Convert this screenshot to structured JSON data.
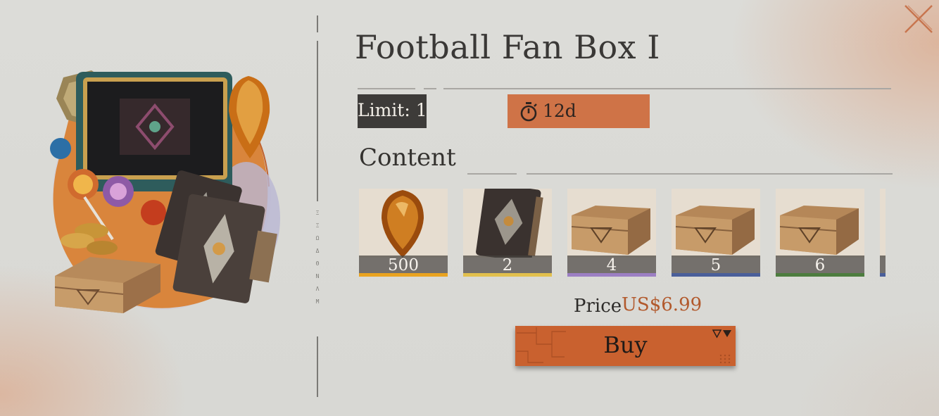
{
  "window": {
    "close_icon": "close-x-icon"
  },
  "hero": {
    "icon": "bundle-art-chest-book-crystal"
  },
  "divider": {
    "glyphs": [
      "Ξ",
      "Ξ",
      "Ω",
      "Δ",
      "Θ",
      "N",
      "Λ",
      "M"
    ]
  },
  "title": "Football Fan Box I",
  "limit_label": "Limit: 1",
  "timer": {
    "icon": "stopwatch-icon",
    "value": "12d"
  },
  "content_label": "Content",
  "items": [
    {
      "icon": "amber-crystal-icon",
      "quantity": "500",
      "rarity_color": "#e9a320"
    },
    {
      "icon": "dark-tome-icon",
      "quantity": "2",
      "rarity_color": "#e2c04d"
    },
    {
      "icon": "wooden-crate-icon",
      "quantity": "4",
      "rarity_color": "#9c7fc3"
    },
    {
      "icon": "wooden-crate-icon",
      "quantity": "5",
      "rarity_color": "#4a5f9a"
    },
    {
      "icon": "wooden-crate-icon",
      "quantity": "6",
      "rarity_color": "#4d7d3f"
    },
    {
      "icon": "wooden-crate-icon",
      "quantity": "",
      "rarity_color": "#4a5f9a"
    }
  ],
  "price": {
    "label": "Price",
    "value": "US$6.99"
  },
  "buy_label": "Buy",
  "colors": {
    "accent": "#cf7347",
    "buy": "#c9612f",
    "price": "#b2592c",
    "limit_bg": "#3d3b39"
  }
}
